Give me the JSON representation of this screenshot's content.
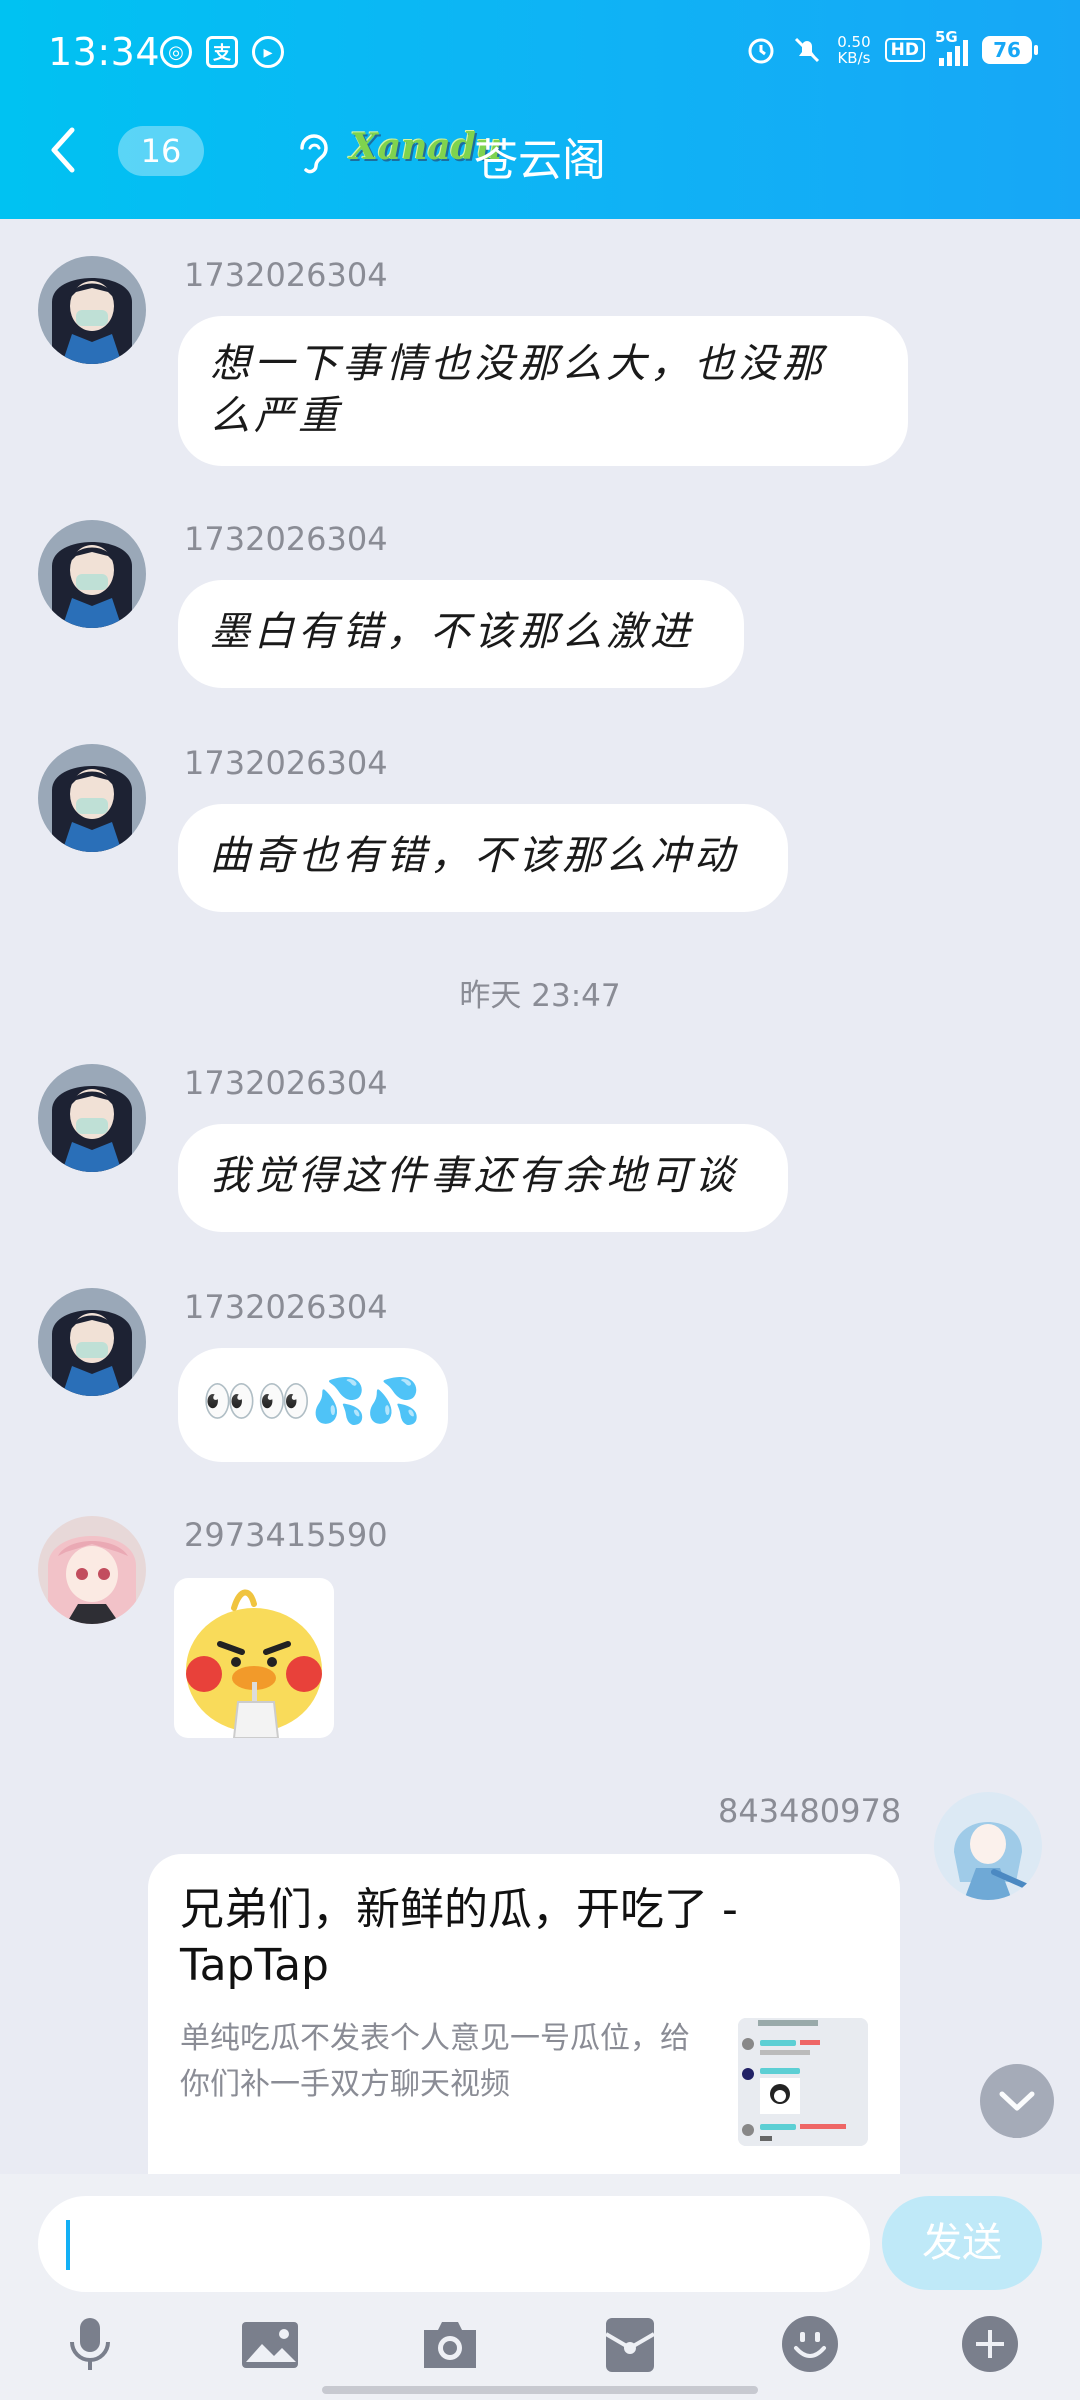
{
  "status_bar": {
    "time": "13:34",
    "net_speed_value": "0.50",
    "net_speed_unit": "KB/s",
    "hd": "HD",
    "network": "5G",
    "battery": "76"
  },
  "header": {
    "unread_count": "16",
    "logo_text": "Xanadu",
    "group_name": "苍云阁"
  },
  "messages": [
    {
      "sender": "1732026304",
      "text": "想一下事情也没那么大，也没那么严重"
    },
    {
      "sender": "1732026304",
      "text": "墨白有错，不该那么激进"
    },
    {
      "sender": "1732026304",
      "text": "曲奇也有错，不该那么冲动"
    },
    {
      "timestamp": "昨天 23:47"
    },
    {
      "sender": "1732026304",
      "text": "我觉得这件事还有余地可谈"
    },
    {
      "sender": "1732026304",
      "text": "👀👀💦💦"
    },
    {
      "sender": "2973415590",
      "sticker": "duck-sticker"
    },
    {
      "sender": "843480978",
      "card_title": "兄弟们，新鲜的瓜，开吃了 - TapTap",
      "card_desc": "单纯吃瓜不发表个人意见一号瓜位，给你们补一手双方聊天视频"
    }
  ],
  "input": {
    "placeholder": "",
    "send_label": "发送"
  },
  "toolbar": [
    "microphone-icon",
    "image-icon",
    "camera-icon",
    "red-packet-icon",
    "emoji-icon",
    "plus-icon"
  ],
  "colors": {
    "header_gradient_start": "#00c2f2",
    "header_gradient_end": "#17a7f6",
    "background": "#e9ebf3",
    "send_disabled": "#bfe9f8"
  }
}
